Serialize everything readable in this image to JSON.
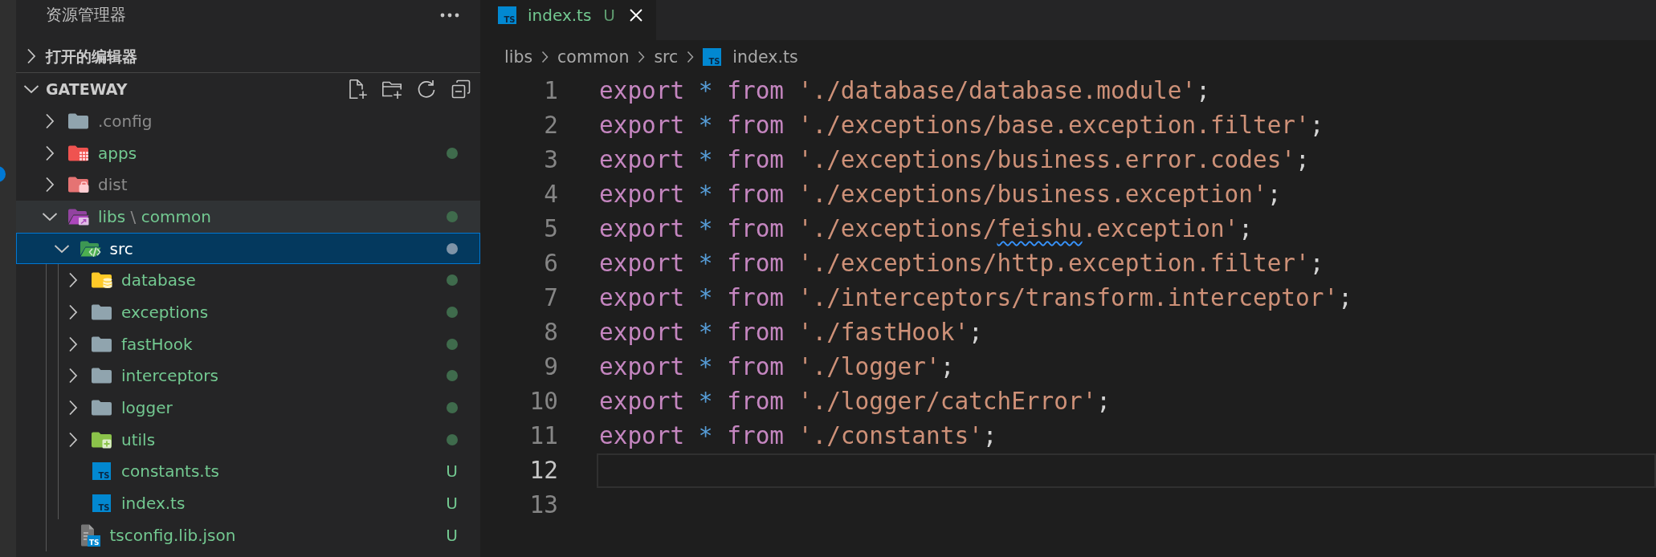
{
  "sidebar": {
    "title": "资源管理器",
    "sections": [
      {
        "title": "打开的编辑器",
        "expanded": false
      },
      {
        "title": "GATEWAY",
        "expanded": true,
        "tree": [
          {
            "label": ".config",
            "kind": "folder",
            "expanded": false,
            "ignored": true,
            "selected": false,
            "hovered": false
          },
          {
            "label": "apps",
            "kind": "apps",
            "expanded": false,
            "ignored": false,
            "selected": false,
            "hovered": false
          },
          {
            "label": "dist",
            "kind": "dist",
            "expanded": false,
            "ignored": true,
            "selected": false,
            "hovered": false
          },
          {
            "label_parts": [
              "libs",
              "common"
            ],
            "separator": "\\",
            "kind": "lib",
            "expanded": true,
            "ignored": false,
            "selected": false,
            "hovered": true,
            "children": [
              {
                "label": "src",
                "kind": "src",
                "expanded": true,
                "ignored": false,
                "selected": true,
                "hovered": false,
                "children": [
                  {
                    "label": "database",
                    "kind": "database",
                    "expanded": false,
                    "ignored": false,
                    "selected": false,
                    "hovered": false
                  },
                  {
                    "label": "exceptions",
                    "kind": "folder",
                    "expanded": false,
                    "ignored": false,
                    "selected": false,
                    "hovered": false
                  },
                  {
                    "label": "fastHook",
                    "kind": "folder",
                    "expanded": false,
                    "ignored": false,
                    "selected": false,
                    "hovered": false
                  },
                  {
                    "label": "interceptors",
                    "kind": "folder",
                    "expanded": false,
                    "ignored": false,
                    "selected": false,
                    "hovered": false
                  },
                  {
                    "label": "logger",
                    "kind": "folder",
                    "expanded": false,
                    "ignored": false,
                    "selected": false,
                    "hovered": false
                  },
                  {
                    "label": "utils",
                    "kind": "utils",
                    "expanded": false,
                    "ignored": false,
                    "selected": false,
                    "hovered": false
                  },
                  {
                    "label": "constants.ts",
                    "kind": "typescript",
                    "icon_text": "TS",
                    "badge": "U",
                    "ignored": false,
                    "selected": false,
                    "hovered": false
                  },
                  {
                    "label": "index.ts",
                    "kind": "typescript",
                    "icon_text": "TS",
                    "badge": "U",
                    "ignored": false,
                    "selected": false,
                    "hovered": false
                  }
                ]
              },
              {
                "label": "tsconfig.lib.json",
                "kind": "tsconfig",
                "icon_text": "TS",
                "badge": "U",
                "ignored": false,
                "selected": false,
                "hovered": false
              }
            ]
          }
        ]
      }
    ]
  },
  "editor": {
    "tabs": [
      {
        "label": "index.ts",
        "kind": "typescript",
        "icon_text": "TS",
        "badge": "U",
        "ignored": false,
        "selected": true
      }
    ],
    "breadcrumb": [
      {
        "label": "libs",
        "kind": "folder"
      },
      {
        "label": "common",
        "kind": "folder"
      },
      {
        "label": "src",
        "kind": "folder"
      },
      {
        "label": "index.ts",
        "kind": "typescript",
        "icon_text": "TS"
      }
    ],
    "lines": [
      {
        "number": "1",
        "current": false,
        "tokens": [
          {
            "kind": "keyword",
            "text": "export"
          },
          {
            "kind": "operator",
            "text": " *"
          },
          {
            "kind": "keyword",
            "text": " from"
          },
          {
            "kind": "string",
            "text": " './database/database.module'"
          },
          {
            "kind": "punctuation",
            "text": ";"
          }
        ]
      },
      {
        "number": "2",
        "current": false,
        "tokens": [
          {
            "kind": "keyword",
            "text": "export"
          },
          {
            "kind": "operator",
            "text": " *"
          },
          {
            "kind": "keyword",
            "text": " from"
          },
          {
            "kind": "string",
            "text": " './exceptions/base.exception.filter'"
          },
          {
            "kind": "punctuation",
            "text": ";"
          }
        ]
      },
      {
        "number": "3",
        "current": false,
        "tokens": [
          {
            "kind": "keyword",
            "text": "export"
          },
          {
            "kind": "operator",
            "text": " *"
          },
          {
            "kind": "keyword",
            "text": " from"
          },
          {
            "kind": "string",
            "text": " './exceptions/business.error.codes'"
          },
          {
            "kind": "punctuation",
            "text": ";"
          }
        ]
      },
      {
        "number": "4",
        "current": false,
        "tokens": [
          {
            "kind": "keyword",
            "text": "export"
          },
          {
            "kind": "operator",
            "text": " *"
          },
          {
            "kind": "keyword",
            "text": " from"
          },
          {
            "kind": "string",
            "text": " './exceptions/business.exception'"
          },
          {
            "kind": "punctuation",
            "text": ";"
          }
        ]
      },
      {
        "number": "5",
        "current": false,
        "tokens": [
          {
            "kind": "keyword",
            "text": "export"
          },
          {
            "kind": "operator",
            "text": " *"
          },
          {
            "kind": "keyword",
            "text": " from"
          },
          {
            "kind": "string",
            "text": " './exceptions/"
          },
          {
            "kind": "flagged",
            "text": "feishu"
          },
          {
            "kind": "string",
            "text": ".exception'"
          },
          {
            "kind": "punctuation",
            "text": ";"
          }
        ]
      },
      {
        "number": "6",
        "current": false,
        "tokens": [
          {
            "kind": "keyword",
            "text": "export"
          },
          {
            "kind": "operator",
            "text": " *"
          },
          {
            "kind": "keyword",
            "text": " from"
          },
          {
            "kind": "string",
            "text": " './exceptions/http.exception.filter'"
          },
          {
            "kind": "punctuation",
            "text": ";"
          }
        ]
      },
      {
        "number": "7",
        "current": false,
        "tokens": [
          {
            "kind": "keyword",
            "text": "export"
          },
          {
            "kind": "operator",
            "text": " *"
          },
          {
            "kind": "keyword",
            "text": " from"
          },
          {
            "kind": "string",
            "text": " './interceptors/transform.interceptor'"
          },
          {
            "kind": "punctuation",
            "text": ";"
          }
        ]
      },
      {
        "number": "8",
        "current": false,
        "tokens": [
          {
            "kind": "keyword",
            "text": "export"
          },
          {
            "kind": "operator",
            "text": " *"
          },
          {
            "kind": "keyword",
            "text": " from"
          },
          {
            "kind": "string",
            "text": " './fastHook'"
          },
          {
            "kind": "punctuation",
            "text": ";"
          }
        ]
      },
      {
        "number": "9",
        "current": false,
        "tokens": [
          {
            "kind": "keyword",
            "text": "export"
          },
          {
            "kind": "operator",
            "text": " *"
          },
          {
            "kind": "keyword",
            "text": " from"
          },
          {
            "kind": "string",
            "text": " './logger'"
          },
          {
            "kind": "punctuation",
            "text": ";"
          }
        ]
      },
      {
        "number": "10",
        "current": false,
        "tokens": [
          {
            "kind": "keyword",
            "text": "export"
          },
          {
            "kind": "operator",
            "text": " *"
          },
          {
            "kind": "keyword",
            "text": " from"
          },
          {
            "kind": "string",
            "text": " './logger/catchError'"
          },
          {
            "kind": "punctuation",
            "text": ";"
          }
        ]
      },
      {
        "number": "11",
        "current": false,
        "tokens": [
          {
            "kind": "keyword",
            "text": "export"
          },
          {
            "kind": "operator",
            "text": " *"
          },
          {
            "kind": "keyword",
            "text": " from"
          },
          {
            "kind": "string",
            "text": " './constants'"
          },
          {
            "kind": "punctuation",
            "text": ";"
          }
        ]
      },
      {
        "number": "12",
        "current": true
      },
      {
        "number": "13",
        "current": false
      }
    ]
  }
}
